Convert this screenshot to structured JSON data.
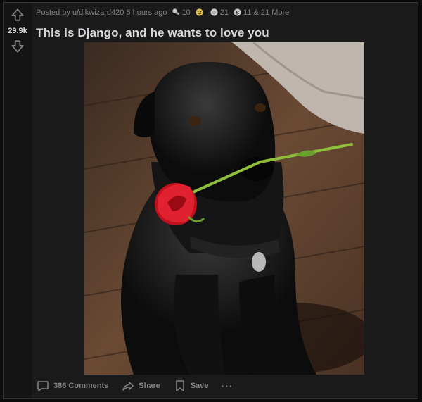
{
  "post": {
    "vote_count": "29.9k",
    "meta": {
      "posted_by": "Posted by u/dikwizard420",
      "time_ago": "5 hours ago",
      "awards": [
        {
          "icon": "helpful-award-icon",
          "count": "10"
        },
        {
          "icon": "wholesome-award-icon",
          "count": ""
        },
        {
          "icon": "silver-award-icon",
          "count": "21"
        },
        {
          "icon": "coin-award-icon",
          "count": "11"
        }
      ],
      "more_awards": "& 21 More"
    },
    "title": "This is Django, and he wants to love you",
    "image": {
      "subject": "dog-with-rose-photo"
    },
    "actions": {
      "comments": "386 Comments",
      "share": "Share",
      "save": "Save",
      "more": "···"
    }
  },
  "colors": {
    "background": "#0b0b0b",
    "card": "#1a1a1b",
    "text": "#d7dadc",
    "muted": "#818384"
  }
}
